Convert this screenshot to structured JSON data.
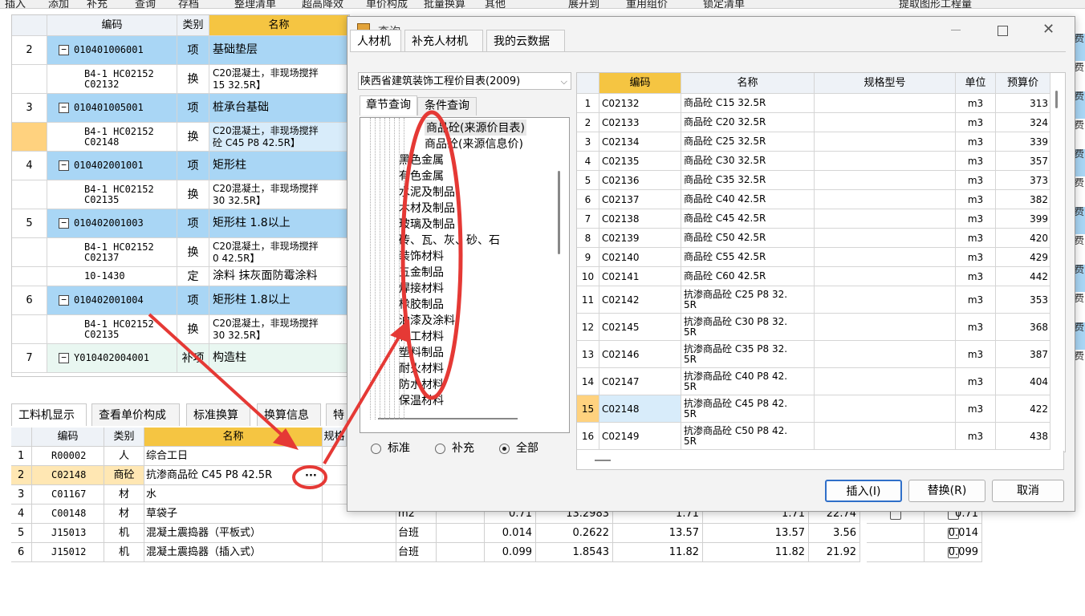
{
  "toolbar": {
    "items": [
      "插入",
      "添加",
      "补充",
      "查询",
      "存档",
      "整理清单",
      "超高降效",
      "单价构成",
      "批量换算",
      "其他",
      "展开到",
      "重用组价",
      "锁定清单",
      "提取图形工程量"
    ]
  },
  "main_grid": {
    "headers": {
      "code": "编码",
      "type": "类别",
      "name": "名称"
    },
    "rows": [
      {
        "num": "2",
        "code": "010401006001",
        "type": "项",
        "name": "基础垫层",
        "style": "hi"
      },
      {
        "code": "B4-1 HC02152\nC02132",
        "type": "换",
        "name": "C20混凝土，非现场搅拌\n15 32.5R】",
        "style": "sub"
      },
      {
        "num": "3",
        "code": "010401005001",
        "type": "项",
        "name": "桩承台基础",
        "style": "hi"
      },
      {
        "code": "B4-1 HC02152\nC02148",
        "type": "换",
        "name": "C20混凝土，非现场搅拌\n砼 C45 P8 42.5R】",
        "style": "sel"
      },
      {
        "num": "4",
        "code": "010402001001",
        "type": "项",
        "name": "矩形柱",
        "style": "hi"
      },
      {
        "code": "B4-1 HC02152\nC02135",
        "type": "换",
        "name": "C20混凝土，非现场搅拌\n30 32.5R】",
        "style": "sub"
      },
      {
        "num": "5",
        "code": "010402001003",
        "type": "项",
        "name": "矩形柱 1.8以上",
        "style": "hi"
      },
      {
        "code": "B4-1 HC02152\nC02137",
        "type": "换",
        "name": "C20混凝土，非现场搅拌\n0 42.5R】",
        "style": "sub"
      },
      {
        "code": "10-1430",
        "type": "定",
        "name": "涂料 抹灰面防霉涂料",
        "style": "sub"
      },
      {
        "num": "6",
        "code": "010402001004",
        "type": "项",
        "name": "矩形柱 1.8以上",
        "style": "hi"
      },
      {
        "code": "B4-1 HC02152\nC02135",
        "type": "换",
        "name": "C20混凝土，非现场搅拌\n30 32.5R】",
        "style": "sub"
      },
      {
        "num": "7",
        "code": "Y010402004001",
        "type": "补项",
        "name": "构造柱",
        "style": "cust"
      }
    ]
  },
  "bottom_tabs": [
    "工料机显示",
    "查看单价构成",
    "标准换算",
    "换算信息",
    "特"
  ],
  "bottom_grid": {
    "headers": {
      "code": "编码",
      "type": "类别",
      "name": "名称",
      "spec": "规格"
    },
    "rows": [
      {
        "num": "1",
        "code": "R00002",
        "type": "人",
        "name": "综合工日",
        "unit": "",
        "v1": "",
        "v2": "",
        "v3": "",
        "v4": "",
        "v5": "",
        "v6": ""
      },
      {
        "num": "2",
        "code": "C02148",
        "type": "商砼",
        "name": "抗渗商品砼 C45 P8 42.5R",
        "unit": "",
        "v1": "",
        "v2": "",
        "v3": "",
        "v4": "",
        "v5": "",
        "v6": ""
      },
      {
        "num": "3",
        "code": "C01167",
        "type": "材",
        "name": "水",
        "unit": "",
        "v1": "",
        "v2": "",
        "v3": "",
        "v4": "",
        "v5": "",
        "v6": ""
      },
      {
        "num": "4",
        "code": "C00148",
        "type": "材",
        "name": "草袋子",
        "unit": "m2",
        "v1": "0.71",
        "v2": "13.2983",
        "v3": "1.71",
        "v4": "1.71",
        "v5": "22.74",
        "v6": "0.71"
      },
      {
        "num": "5",
        "code": "J15013",
        "type": "机",
        "name": "混凝土震捣器（平板式）",
        "unit": "台班",
        "v1": "0.014",
        "v2": "0.2622",
        "v3": "13.57",
        "v4": "13.57",
        "v5": "3.56",
        "v6": "0.014"
      },
      {
        "num": "6",
        "code": "J15012",
        "type": "机",
        "name": "混凝土震捣器（插入式）",
        "unit": "台班",
        "v1": "0.099",
        "v2": "1.8543",
        "v3": "11.82",
        "v4": "11.82",
        "v5": "21.92",
        "v6": "0.099"
      }
    ],
    "ellipsis": "···"
  },
  "dialog": {
    "title": "查询",
    "tabs": [
      "人材机",
      "补充人材机",
      "我的云数据"
    ],
    "db_select": "陕西省建筑装饰工程价目表(2009)",
    "sub_tabs": [
      "章节查询",
      "条件查询"
    ],
    "tree": [
      "商品砼(来源价目表)",
      "商品砼(来源信息价)",
      "黑色金属",
      "有色金属",
      "水泥及制品",
      "木材及制品",
      "玻璃及制品",
      "砖、瓦、灰、砂、石",
      "装饰材料",
      "五金制品",
      "焊接材料",
      "橡胶制品",
      "油漆及涂料",
      "化工材料",
      "塑料制品",
      "耐火材料",
      "防水材料",
      "保温材料"
    ],
    "radios": [
      "标准",
      "补充",
      "全部"
    ],
    "table_headers": {
      "code": "编码",
      "name": "名称",
      "spec": "规格型号",
      "unit": "单位",
      "price": "预算价"
    },
    "rows": [
      {
        "n": "1",
        "code": "C02132",
        "name": "商品砼 C15 32.5R",
        "unit": "m3",
        "price": "313"
      },
      {
        "n": "2",
        "code": "C02133",
        "name": "商品砼 C20 32.5R",
        "unit": "m3",
        "price": "324"
      },
      {
        "n": "3",
        "code": "C02134",
        "name": "商品砼 C25 32.5R",
        "unit": "m3",
        "price": "339"
      },
      {
        "n": "4",
        "code": "C02135",
        "name": "商品砼 C30 32.5R",
        "unit": "m3",
        "price": "357"
      },
      {
        "n": "5",
        "code": "C02136",
        "name": "商品砼 C35 32.5R",
        "unit": "m3",
        "price": "373"
      },
      {
        "n": "6",
        "code": "C02137",
        "name": "商品砼 C40 42.5R",
        "unit": "m3",
        "price": "382"
      },
      {
        "n": "7",
        "code": "C02138",
        "name": "商品砼 C45 42.5R",
        "unit": "m3",
        "price": "399"
      },
      {
        "n": "8",
        "code": "C02139",
        "name": "商品砼 C50 42.5R",
        "unit": "m3",
        "price": "420"
      },
      {
        "n": "9",
        "code": "C02140",
        "name": "商品砼 C55 42.5R",
        "unit": "m3",
        "price": "429"
      },
      {
        "n": "10",
        "code": "C02141",
        "name": "商品砼 C60 42.5R",
        "unit": "m3",
        "price": "442"
      },
      {
        "n": "11",
        "code": "C02142",
        "name": "抗渗商品砼 C25 P8 32.\n5R",
        "unit": "m3",
        "price": "353"
      },
      {
        "n": "12",
        "code": "C02145",
        "name": "抗渗商品砼 C30 P8 32.\n5R",
        "unit": "m3",
        "price": "368"
      },
      {
        "n": "13",
        "code": "C02146",
        "name": "抗渗商品砼 C35 P8 32.\n5R",
        "unit": "m3",
        "price": "387"
      },
      {
        "n": "14",
        "code": "C02147",
        "name": "抗渗商品砼 C40 P8 42.\n5R",
        "unit": "m3",
        "price": "404"
      },
      {
        "n": "15",
        "code": "C02148",
        "name": "抗渗商品砼 C45 P8 42.\n5R",
        "unit": "m3",
        "price": "422"
      },
      {
        "n": "16",
        "code": "C02149",
        "name": "抗渗商品砼 C50 P8 42.\n5R",
        "unit": "m3",
        "price": "438"
      }
    ],
    "buttons": {
      "insert": "插入(I)",
      "replace": "替换(R)",
      "cancel": "取消"
    }
  },
  "right_strip": [
    "费",
    "费",
    "费",
    "费",
    "费",
    "费",
    "费",
    "费",
    "费",
    "费",
    "费",
    "费"
  ]
}
